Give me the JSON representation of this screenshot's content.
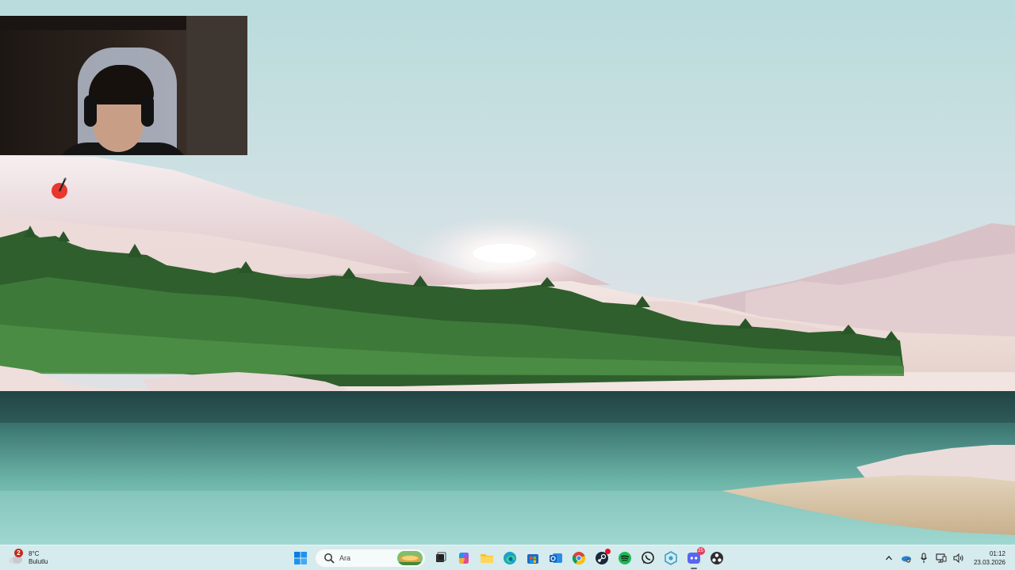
{
  "taskbar": {
    "weather": {
      "icon": "cloud-icon",
      "badge": "2",
      "temperature": "8°C",
      "condition": "Bulutlu"
    },
    "search": {
      "icon": "search-icon",
      "placeholder": "Ara"
    },
    "apps": [
      {
        "name": "start-button",
        "icon": "windows-logo-icon"
      },
      {
        "name": "task-view-button",
        "icon": "task-view-icon"
      },
      {
        "name": "copilot-button",
        "icon": "copilot-icon"
      },
      {
        "name": "file-explorer-button",
        "icon": "folder-icon"
      },
      {
        "name": "edge-button",
        "icon": "edge-icon"
      },
      {
        "name": "microsoft-store-button",
        "icon": "store-icon"
      },
      {
        "name": "outlook-button",
        "icon": "outlook-icon"
      },
      {
        "name": "chrome-button",
        "icon": "chrome-icon"
      },
      {
        "name": "steam-button",
        "icon": "steam-icon"
      },
      {
        "name": "spotify-button",
        "icon": "spotify-icon"
      },
      {
        "name": "whatsapp-button",
        "icon": "whatsapp-icon"
      },
      {
        "name": "app-hex-button",
        "icon": "hex-app-icon"
      },
      {
        "name": "discord-button",
        "icon": "discord-icon",
        "badge": "25"
      },
      {
        "name": "obs-button",
        "icon": "obs-icon"
      }
    ],
    "tray": {
      "icons": [
        "chevron-up-icon",
        "onedrive-icon",
        "microphone-icon",
        "network-icon",
        "volume-icon"
      ],
      "time": "01:12",
      "date": "23.03.2026"
    }
  },
  "desktop": {
    "icon": "pen-tool-icon"
  },
  "colors": {
    "taskbar_bg": "#d6ecee",
    "badge_red": "#c42b1c",
    "accent_blue": "#0078d4"
  }
}
